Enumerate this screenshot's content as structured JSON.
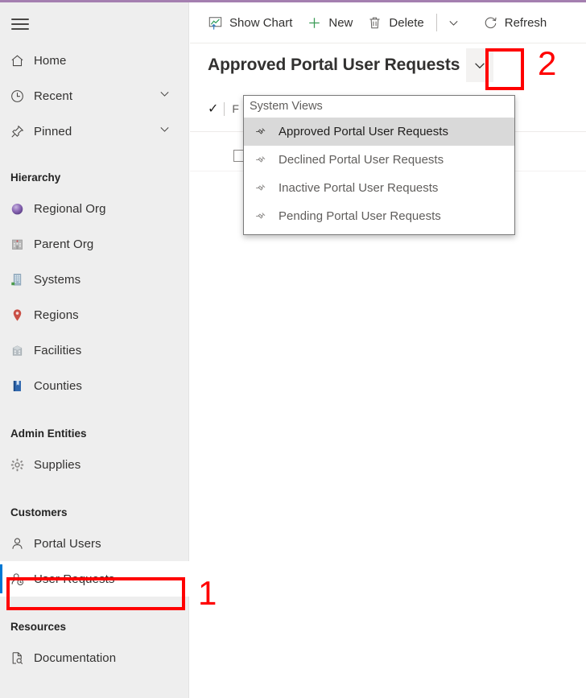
{
  "theme": {
    "accent_bar": "#a47fb0",
    "sidebar_bg": "#eeeeee",
    "selection_blue": "#0078d4",
    "annotation_red": "#ff0000",
    "menu_highlight": "#d9d9d9"
  },
  "sidebar": {
    "menu_button": "menu",
    "items": [
      {
        "label": "Home",
        "icon": "home-icon",
        "expandable": false
      },
      {
        "label": "Recent",
        "icon": "clock-icon",
        "expandable": true
      },
      {
        "label": "Pinned",
        "icon": "pin-icon",
        "expandable": true
      }
    ],
    "groups": [
      {
        "title": "Hierarchy",
        "items": [
          {
            "label": "Regional Org",
            "icon": "sphere-icon"
          },
          {
            "label": "Parent Org",
            "icon": "hospital-icon"
          },
          {
            "label": "Systems",
            "icon": "office-building-icon"
          },
          {
            "label": "Regions",
            "icon": "map-pin-icon"
          },
          {
            "label": "Facilities",
            "icon": "building-icon"
          },
          {
            "label": "Counties",
            "icon": "book-icon"
          }
        ]
      },
      {
        "title": "Admin Entities",
        "items": [
          {
            "label": "Supplies",
            "icon": "gear-icon"
          }
        ]
      },
      {
        "title": "Customers",
        "items": [
          {
            "label": "Portal Users",
            "icon": "person-icon",
            "selected": false
          },
          {
            "label": "User Requests",
            "icon": "person-clock-icon",
            "selected": true
          }
        ]
      },
      {
        "title": "Resources",
        "items": [
          {
            "label": "Documentation",
            "icon": "page-search-icon"
          }
        ]
      }
    ]
  },
  "commandbar": {
    "buttons": [
      {
        "label": "Show Chart",
        "icon": "chart-icon"
      },
      {
        "label": "New",
        "icon": "plus-icon"
      },
      {
        "label": "Delete",
        "icon": "trash-icon"
      }
    ],
    "overflow_icon": "chevron-down-icon",
    "refresh": {
      "label": "Refresh",
      "icon": "refresh-icon"
    }
  },
  "view": {
    "title": "Approved Portal User Requests",
    "selector_icon": "chevron-down-icon"
  },
  "dropdown": {
    "header": "System Views",
    "items": [
      {
        "label": "Approved Portal User Requests",
        "icon": "pin-icon",
        "selected": true
      },
      {
        "label": "Declined Portal User Requests",
        "icon": "pin-icon",
        "selected": false
      },
      {
        "label": "Inactive Portal User Requests",
        "icon": "pin-icon",
        "selected": false
      },
      {
        "label": "Pending Portal User Requests",
        "icon": "pin-icon",
        "selected": false
      }
    ]
  },
  "subbar": {
    "check_icon": "checkmark-icon",
    "partial_label": "F"
  },
  "annotations": [
    {
      "number": "1",
      "target": "sidebar-item-user-requests"
    },
    {
      "number": "2",
      "target": "view-selector-caret"
    }
  ]
}
